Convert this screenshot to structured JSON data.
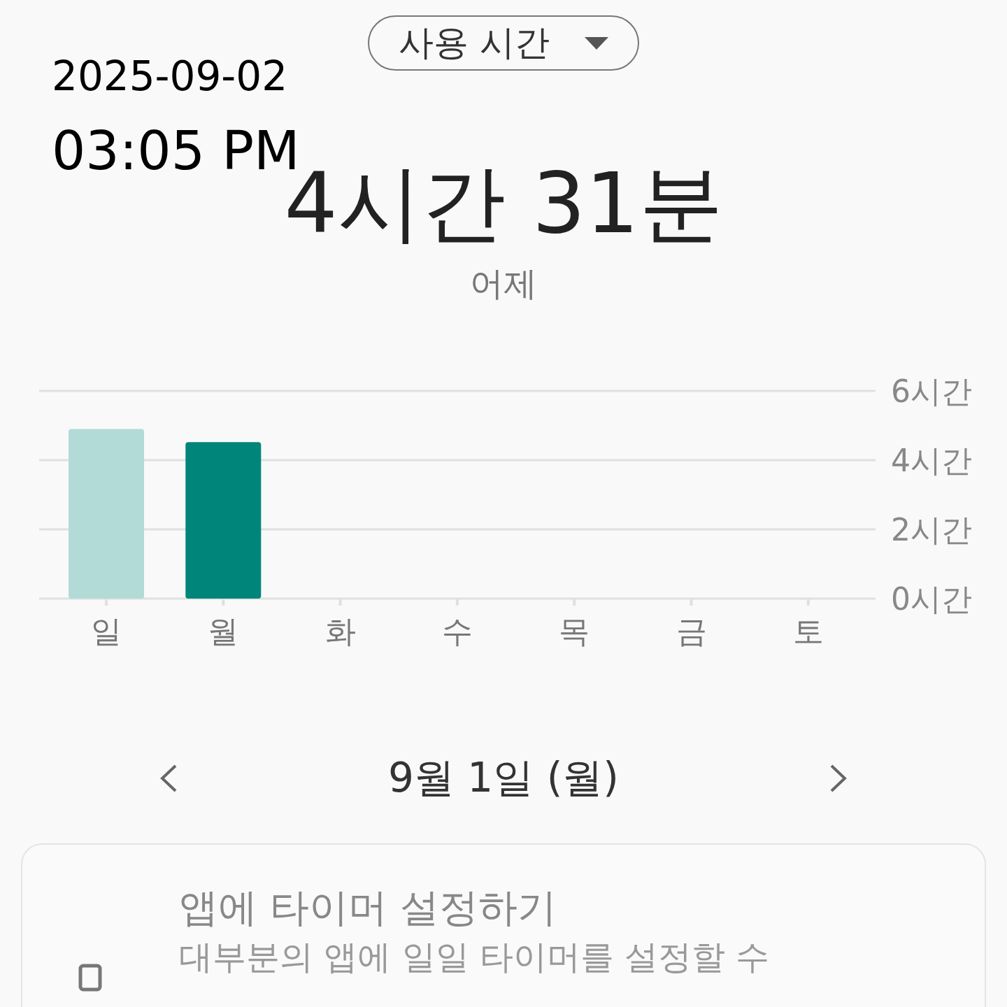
{
  "stamp": {
    "date": "2025-09-02",
    "time": "03:05 PM"
  },
  "dropdown": {
    "label": "사용 시간"
  },
  "total": {
    "value": "4시간 31분",
    "caption": "어제"
  },
  "chart": {
    "chart_data": {
      "type": "bar",
      "categories": [
        "일",
        "월",
        "화",
        "수",
        "목",
        "금",
        "토"
      ],
      "series": [
        {
          "color": "#b2dbd7",
          "values": [
            4.9,
            null,
            0,
            0,
            0,
            0,
            0
          ]
        },
        {
          "color": "#00857a",
          "values": [
            null,
            4.52,
            null,
            null,
            null,
            null,
            null
          ]
        }
      ],
      "stacked": true,
      "ylim": [
        0,
        6
      ],
      "yticks": [
        {
          "value": 0,
          "label": "0시간"
        },
        {
          "value": 2,
          "label": "2시간"
        },
        {
          "value": 4,
          "label": "4시간"
        },
        {
          "value": 6,
          "label": "6시간"
        }
      ]
    }
  },
  "day_nav": {
    "label": "9월 1일 (월)"
  },
  "timer_card": {
    "title": "앱에 타이머 설정하기",
    "description": "대부분의 앱에 일일 타이머를 설정할 수"
  }
}
